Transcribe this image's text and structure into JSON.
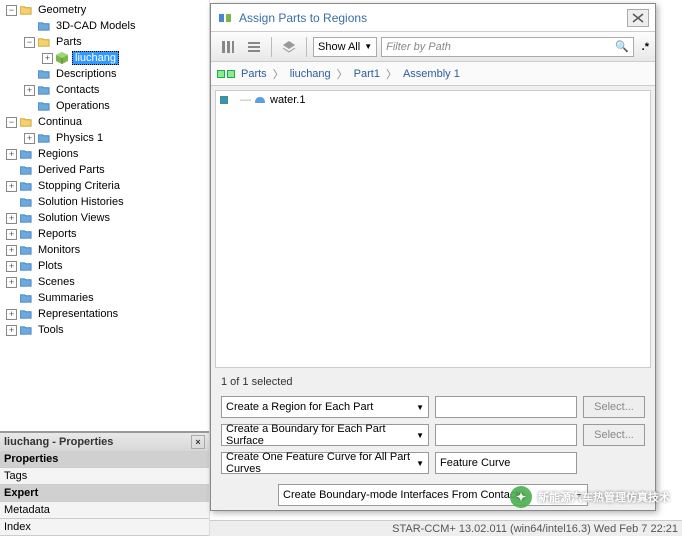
{
  "tree": [
    {
      "d": 0,
      "pm": "-",
      "ico": "fold-open",
      "label": "Geometry"
    },
    {
      "d": 1,
      "pm": " ",
      "ico": "fold-blue",
      "label": "3D-CAD Models"
    },
    {
      "d": 1,
      "pm": "-",
      "ico": "fold-open",
      "label": "Parts"
    },
    {
      "d": 2,
      "pm": "+",
      "ico": "cube",
      "label": "liuchang",
      "sel": true
    },
    {
      "d": 1,
      "pm": " ",
      "ico": "fold-blue",
      "label": "Descriptions"
    },
    {
      "d": 1,
      "pm": "+",
      "ico": "fold-blue",
      "label": "Contacts"
    },
    {
      "d": 1,
      "pm": " ",
      "ico": "fold-blue",
      "label": "Operations"
    },
    {
      "d": 0,
      "pm": "-",
      "ico": "fold-open",
      "label": "Continua"
    },
    {
      "d": 1,
      "pm": "+",
      "ico": "fold-blue",
      "label": "Physics 1"
    },
    {
      "d": 0,
      "pm": "+",
      "ico": "fold-blue",
      "label": "Regions"
    },
    {
      "d": 0,
      "pm": " ",
      "ico": "fold-blue",
      "label": "Derived Parts"
    },
    {
      "d": 0,
      "pm": "+",
      "ico": "fold-blue",
      "label": "Stopping Criteria"
    },
    {
      "d": 0,
      "pm": " ",
      "ico": "fold-blue",
      "label": "Solution Histories"
    },
    {
      "d": 0,
      "pm": "+",
      "ico": "fold-blue",
      "label": "Solution Views"
    },
    {
      "d": 0,
      "pm": "+",
      "ico": "fold-blue",
      "label": "Reports"
    },
    {
      "d": 0,
      "pm": "+",
      "ico": "fold-blue",
      "label": "Monitors"
    },
    {
      "d": 0,
      "pm": "+",
      "ico": "fold-blue",
      "label": "Plots"
    },
    {
      "d": 0,
      "pm": "+",
      "ico": "fold-blue",
      "label": "Scenes"
    },
    {
      "d": 0,
      "pm": " ",
      "ico": "fold-blue",
      "label": "Summaries"
    },
    {
      "d": 0,
      "pm": "+",
      "ico": "fold-blue",
      "label": "Representations"
    },
    {
      "d": 0,
      "pm": "+",
      "ico": "fold-blue",
      "label": "Tools"
    }
  ],
  "properties": {
    "title": "liuchang - Properties",
    "rows": [
      "Properties",
      "Tags",
      "Expert",
      "Metadata",
      "Index"
    ]
  },
  "dialog": {
    "title": "Assign Parts to Regions",
    "toolbar": {
      "show_label": "Show All",
      "filter_placeholder": "Filter by Path"
    },
    "breadcrumb": [
      "Parts",
      "liuchang",
      "Part1",
      "Assembly 1"
    ],
    "list": [
      "water.1"
    ],
    "selection_text": "1 of 1 selected",
    "region_combo": "Create a Region for Each Part",
    "boundary_combo": "Create a Boundary for Each Part Surface",
    "feature_combo": "Create One Feature Curve for All Part Curves",
    "feature_value": "Feature Curve",
    "interface_combo": "Create Boundary-mode Interfaces From Contacts",
    "select_btn": "Select..."
  },
  "status": {
    "text": "STAR-CCM+ 13.02.011 (win64/intel16.3) Wed Feb 7 22:21"
  },
  "watermark": {
    "text": "新能源汽车热管理仿真技术"
  },
  "icons": {
    "fold-open": "<svg viewBox='0 0 14 12'><path d='M0 2 h5 l1 1 h6 v7 h-12 z' fill='#f6d06b' stroke='#c9a030'/></svg>",
    "fold-blue": "<svg viewBox='0 0 14 12'><path d='M0 2 h5 l1 1 h6 v7 h-12 z' fill='#6fa8dc' stroke='#3d85c6'/></svg>",
    "cube": "<svg viewBox='0 0 12 12'><path d='M6 0 L12 3 L12 9 L6 12 L0 9 L0 3 Z' fill='#7ab648'/><path d='M6 0 L12 3 L6 6 L0 3 Z' fill='#a4d47a'/><path d='M6 6 L6 12' stroke='#5a8a35'/></svg>"
  }
}
